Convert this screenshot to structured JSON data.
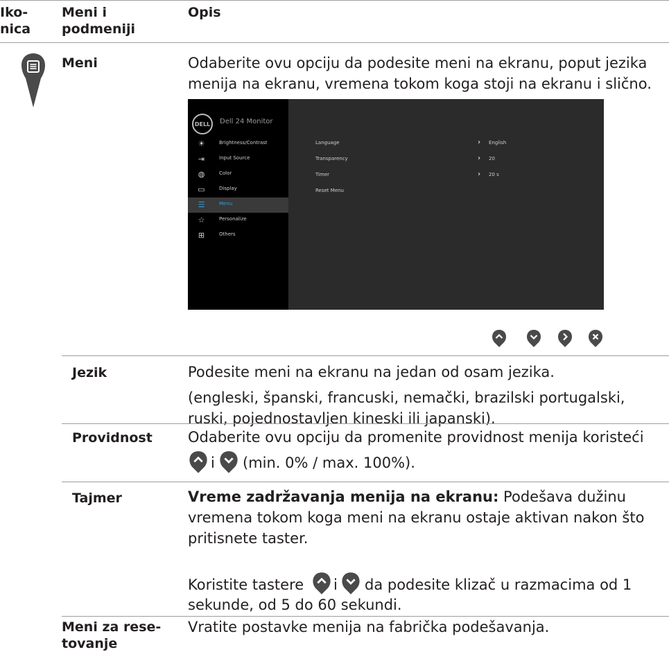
{
  "header": {
    "col1": "Iko-\nnica",
    "col1_a": "Iko-",
    "col1_b": "nica",
    "col2_a": "Meni i",
    "col2_b": "podmeniji",
    "col3": "Opis"
  },
  "main_row": {
    "icon": "menu-marker-icon",
    "label": "Meni",
    "desc_line1": "Odaberite ovu opciju da podesite meni na ekranu, poput jezika",
    "desc_line2": "menija na ekranu, vremena tokom koga stoji na ekranu i slično."
  },
  "osd": {
    "logo": "DELL",
    "title": "Dell 24 Monitor",
    "menu_items": [
      {
        "label": "Brightness/Contrast",
        "icon": "sun-icon"
      },
      {
        "label": "Input Source",
        "icon": "input-icon"
      },
      {
        "label": "Color",
        "icon": "palette-icon"
      },
      {
        "label": "Display",
        "icon": "monitor-icon"
      },
      {
        "label": "Menu",
        "icon": "menu-icon",
        "active": true
      },
      {
        "label": "Personalize",
        "icon": "star-icon"
      },
      {
        "label": "Others",
        "icon": "sliders-icon"
      }
    ],
    "settings": [
      {
        "name": "Language",
        "value": "English"
      },
      {
        "name": "Transparency",
        "value": "20"
      },
      {
        "name": "Timer",
        "value": "20 s"
      },
      {
        "name": "Reset Menu",
        "value": ""
      }
    ],
    "accent_color": "#2e9fd8"
  },
  "nav_buttons": [
    "up-button-icon",
    "down-button-icon",
    "right-button-icon",
    "close-button-icon"
  ],
  "rows": {
    "jezik": {
      "label": "Jezik",
      "line1": "Podesite meni na ekranu na jedan od osam jezika.",
      "line2": "(engleski, španski, francuski, nemački, brazilski portugalski,",
      "line3": "ruski, pojednostavljen kineski ili japanski)."
    },
    "providnost": {
      "label": "Providnost",
      "line1": "Odaberite ovu opciju da promenite providnost menija koristeći",
      "conj": "i",
      "line2_rest": "(min. 0% / max. 100%)."
    },
    "tajmer": {
      "label": "Tajmer",
      "bold_lead": "Vreme zadržavanja menija na ekranu:",
      "line1_rest": " Podešava dužinu",
      "line2": "vremena tokom koga meni na ekranu ostaje aktivan nakon što",
      "line3": "pritisnete taster.",
      "line4_a": "Koristite tastere",
      "conj": "i",
      "line4_b": "da podesite klizač u razmacima od 1",
      "line5": "sekunde, od 5 do 60 sekundi."
    },
    "reset": {
      "label_a": "Meni za rese-",
      "label_b": "tovanje",
      "desc": "Vratite postavke menija na fabrička podešavanja."
    }
  }
}
